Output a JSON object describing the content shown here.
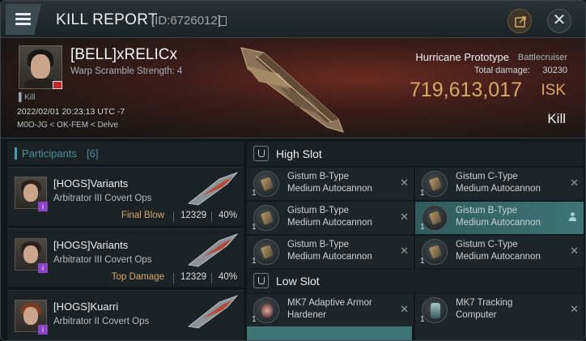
{
  "header": {
    "title": "KILL REPORT",
    "id_label": "[ID:6726012]"
  },
  "victim": {
    "pilot": "[BELL]xRELICx",
    "subtitle": "Warp Scramble Strength: 4",
    "kill_tag": "Kill",
    "timestamp": "2022/02/01 20:23:13 UTC -7",
    "location": "M0O-JG < OK-FEM < Delve",
    "ship_name": "Hurricane Prototype",
    "ship_class": "Battlecruiser",
    "damage_label": "Total damage:",
    "damage_value": "30230",
    "isk_value": "719,613,017",
    "isk_unit": "ISK",
    "outcome": "Kill"
  },
  "participants": {
    "label": "Participants",
    "count": "[6]",
    "rows": [
      {
        "name": "[HOGS]Variants",
        "ship": "Arbitrator III Covert Ops",
        "tag": "Final Blow",
        "damage": "12329",
        "percent": "40%"
      },
      {
        "name": "[HOGS]Variants",
        "ship": "Arbitrator III Covert Ops",
        "tag": "Top Damage",
        "damage": "12329",
        "percent": "40%"
      },
      {
        "name": "[HOGS]Kuarri",
        "ship": "Arbitrator II Covert Ops",
        "tag": "",
        "damage": "",
        "percent": ""
      }
    ]
  },
  "high_slot": {
    "label": "High Slot",
    "items": [
      {
        "line1": "Gistum B-Type",
        "line2": "Medium Autocannon",
        "qty": "1",
        "icon": "gun"
      },
      {
        "line1": "Gistum C-Type",
        "line2": "Medium Autocannon",
        "qty": "1",
        "icon": "gun"
      },
      {
        "line1": "Gistum B-Type",
        "line2": "Medium Autocannon",
        "qty": "1",
        "icon": "gun"
      },
      {
        "line1": "Gistum B-Type",
        "line2": "Medium Autocannon",
        "qty": "1",
        "icon": "gun",
        "active": true
      },
      {
        "line1": "Gistum B-Type",
        "line2": "Medium Autocannon",
        "qty": "1",
        "icon": "gun"
      },
      {
        "line1": "Gistum C-Type",
        "line2": "Medium Autocannon",
        "qty": "1",
        "icon": "gun"
      }
    ]
  },
  "low_slot": {
    "label": "Low Slot",
    "items": [
      {
        "line1": "MK7 Adaptive Armor",
        "line2": "Hardener",
        "qty": "1",
        "icon": "armor"
      },
      {
        "line1": "MK7 Tracking",
        "line2": "Computer",
        "qty": "1",
        "icon": "comp"
      }
    ]
  },
  "colors": {
    "accent_teal": "#3ea0b0",
    "isk_gold": "#d6a868",
    "active_slot": "#3d7475",
    "badge_purple": "#8d43c9"
  }
}
